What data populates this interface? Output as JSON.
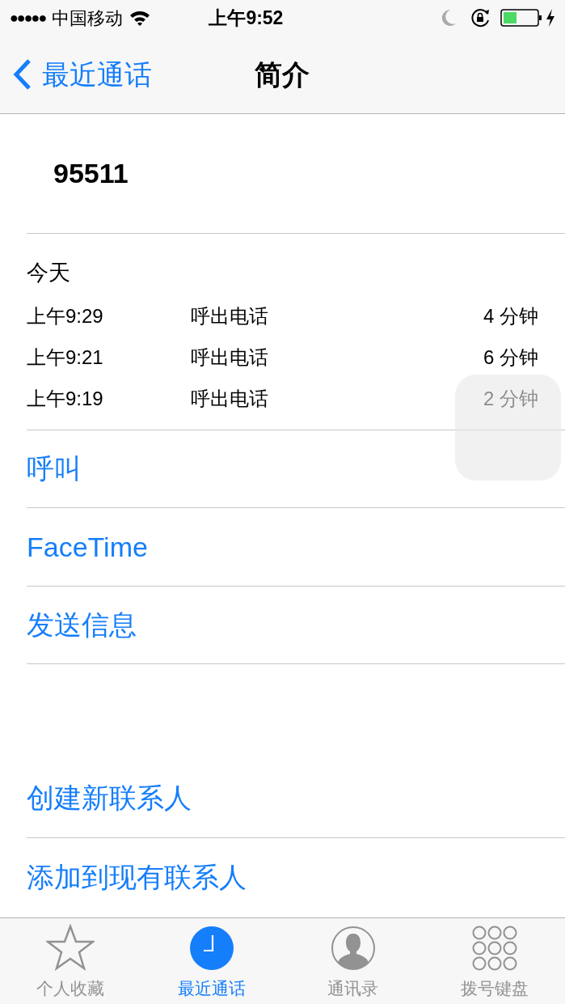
{
  "status_bar": {
    "signal_dots": "●●●●●",
    "carrier": "中国移动",
    "time": "上午9:52"
  },
  "nav_bar": {
    "back": "最近通话",
    "title": "简介"
  },
  "number": "95511",
  "calls": {
    "day": "今天",
    "rows": [
      {
        "time": "上午9:29",
        "type": "呼出电话",
        "duration": "4 分钟"
      },
      {
        "time": "上午9:21",
        "type": "呼出电话",
        "duration": "6 分钟"
      },
      {
        "time": "上午9:19",
        "type": "呼出电话",
        "duration": "2 分钟"
      }
    ]
  },
  "actions": [
    "呼叫",
    "FaceTime",
    "发送信息"
  ],
  "contact_actions": [
    "创建新联系人",
    "添加到现有联系人"
  ],
  "tab_bar": [
    {
      "kind": "star",
      "label": "个人收藏",
      "selected": false
    },
    {
      "kind": "clock",
      "label": "最近通话",
      "selected": true
    },
    {
      "kind": "person",
      "label": "通讯录",
      "selected": false
    },
    {
      "kind": "keypad",
      "label": "拨号键盘",
      "selected": false
    }
  ]
}
